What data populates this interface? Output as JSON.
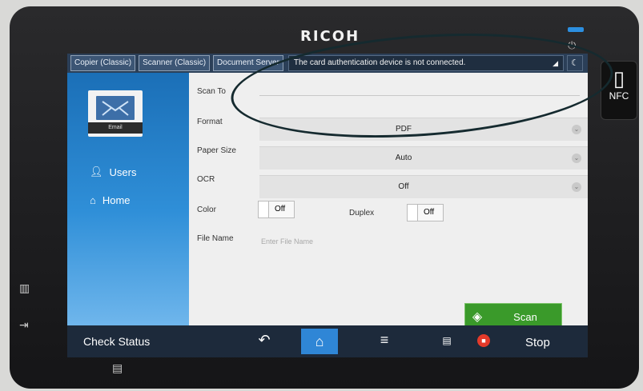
{
  "device": {
    "brand": "RICOH",
    "nfc_label": "NFC"
  },
  "tabs": [
    {
      "label": "Copier (Classic)"
    },
    {
      "label": "Scanner (Classic)"
    },
    {
      "label": "Document Server"
    }
  ],
  "status_message": "The card authentication device is not connected.",
  "sidebar": {
    "email_label": "Email",
    "users_label": "Users",
    "home_label": "Home"
  },
  "form": {
    "scan_to_label": "Scan To",
    "format_label": "Format",
    "format_value": "PDF",
    "paper_size_label": "Paper Size",
    "paper_size_value": "Auto",
    "ocr_label": "OCR",
    "ocr_value": "Off",
    "color_label": "Color",
    "color_value": "Off",
    "duplex_label": "Duplex",
    "duplex_value": "Off",
    "file_name_label": "File Name",
    "file_name_placeholder": "Enter File Name",
    "file_name_value": ""
  },
  "scan_button_label": "Scan",
  "bottom_bar": {
    "check_status_label": "Check Status",
    "stop_label": "Stop"
  },
  "colors": {
    "sidebar_blue": "#1b6fb7",
    "scan_green": "#3a9a2a",
    "home_blue": "#2f86d6",
    "stop_red": "#e43a2a"
  }
}
